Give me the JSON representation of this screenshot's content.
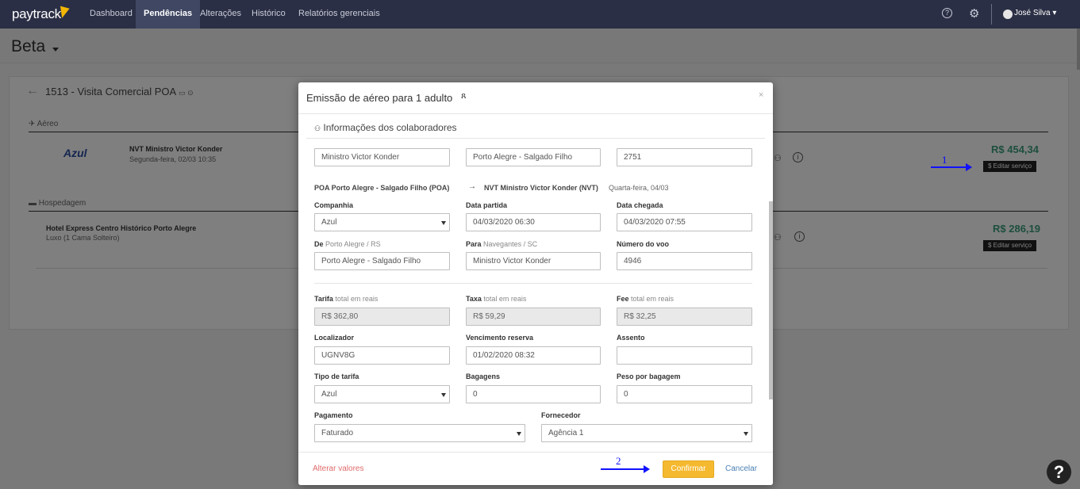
{
  "navbar": {
    "logo": "paytrack",
    "items": [
      "Dashboard",
      "Pendências",
      "Alterações",
      "Histórico",
      "Relatórios gerenciais"
    ],
    "user": "José Silva"
  },
  "page": {
    "title": "Beta"
  },
  "trip": {
    "title": "1513 - Visita Comercial POA",
    "air_section": "Aéreo",
    "hotel_section": "Hospedagem",
    "flight": {
      "airline_logo": "Azul",
      "title": "NVT Ministro Victor Konder",
      "subtitle": "Segunda-feira, 02/03 10:35",
      "price": "R$ 454,34",
      "edit_label": "$ Editar serviço"
    },
    "hotel": {
      "title": "Hotel Express Centro Histórico Porto Alegre",
      "subtitle": "Luxo (1 Cama Solteiro)",
      "price": "R$ 286,19",
      "edit_label": "$ Editar serviço"
    }
  },
  "annotations": {
    "one": "1",
    "two": "2"
  },
  "modal": {
    "title": "Emissão de aéreo para 1 adulto",
    "close": "×",
    "section_title": "Informações dos colaboradores",
    "top_inputs": [
      "Ministro Victor Konder",
      "Porto Alegre - Salgado Filho",
      "2751"
    ],
    "route": {
      "origin": "POA Porto Alegre - Salgado Filho (POA)",
      "arrow": "→",
      "destination": "NVT Ministro Victor Konder (NVT)",
      "date": "Quarta-feira, 04/03"
    },
    "labels": {
      "companhia": "Companhia",
      "data_partida": "Data partida",
      "data_chegada": "Data chegada",
      "de": "De",
      "de_light": "Porto Alegre / RS",
      "para": "Para",
      "para_light": "Navegantes / SC",
      "numero_voo": "Número do voo",
      "tarifa": "Tarifa",
      "taxa": "Taxa",
      "fee": "Fee",
      "total_em_reais": "total em reais",
      "localizador": "Localizador",
      "vencimento": "Vencimento reserva",
      "assento": "Assento",
      "tipo_tarifa": "Tipo de tarifa",
      "bagagens": "Bagagens",
      "peso": "Peso por bagagem",
      "pagamento": "Pagamento",
      "fornecedor": "Fornecedor"
    },
    "values": {
      "companhia": "Azul",
      "data_partida": "04/03/2020 06:30",
      "data_chegada": "04/03/2020 07:55",
      "de": "Porto Alegre - Salgado Filho",
      "para": "Ministro Victor Konder",
      "numero_voo": "4946",
      "tarifa": "R$ 362,80",
      "taxa": "R$ 59,29",
      "fee": "R$ 32,25",
      "localizador": "UGNV8G",
      "vencimento": "01/02/2020 08:32",
      "assento": "",
      "tipo_tarifa": "Azul",
      "bagagens": "0",
      "peso": "0",
      "pagamento": "Faturado",
      "fornecedor": "Agência 1"
    },
    "footer": {
      "alter": "Alterar valores",
      "confirm": "Confirmar",
      "cancel": "Cancelar"
    }
  },
  "help": "?"
}
